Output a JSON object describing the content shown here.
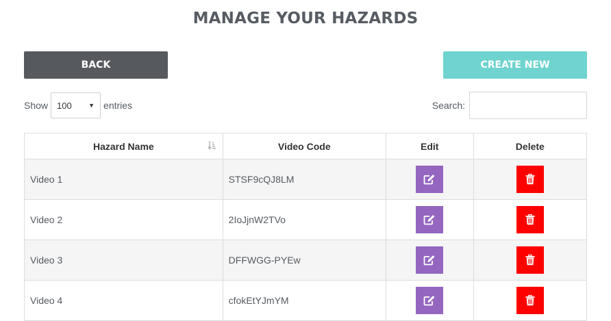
{
  "page": {
    "title": "MANAGE YOUR HAZARDS"
  },
  "actions": {
    "back_label": "BACK",
    "create_label": "CREATE NEW"
  },
  "length": {
    "show_label": "Show",
    "value": "100",
    "entries_label": "entries"
  },
  "search": {
    "label": "Search:",
    "value": ""
  },
  "table": {
    "columns": [
      "Hazard Name",
      "Video Code",
      "Edit",
      "Delete"
    ],
    "rows": [
      {
        "name": "Video 1",
        "code": "STSF9cQJ8LM"
      },
      {
        "name": "Video 2",
        "code": "2IoJjnW2TVo"
      },
      {
        "name": "Video 3",
        "code": "DFFWGG-PYEw"
      },
      {
        "name": "Video 4",
        "code": "cfokEtYJmYM"
      }
    ]
  },
  "icons": {
    "sort": "sort-amount-icon",
    "edit": "edit-icon",
    "delete": "trash-icon"
  },
  "colors": {
    "back": "#56595e",
    "create": "#6fd3cf",
    "edit": "#9466c0",
    "delete": "#ff0000",
    "title": "#575c63"
  }
}
